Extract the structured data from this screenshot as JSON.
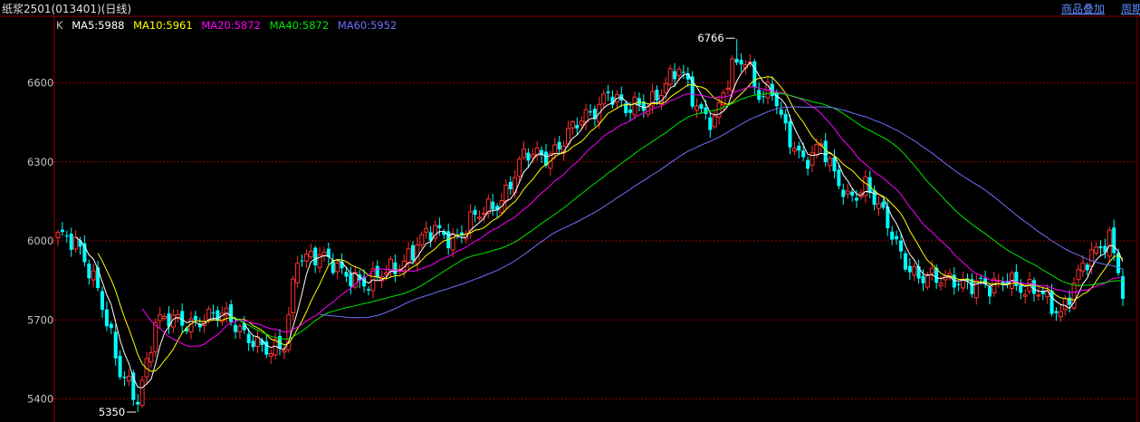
{
  "header": {
    "title": "纸浆2501(013401)(日线)",
    "overlay_link": "商品叠加",
    "period_link": "周期"
  },
  "legend": {
    "k_label": "K",
    "ma5": "MA5:5988",
    "ma10": "MA10:5961",
    "ma20": "MA20:5872",
    "ma40": "MA40:5872",
    "ma60": "MA60:5952"
  },
  "colors": {
    "up": "#ff3232",
    "down": "#00ffff",
    "ma5": "#ffffff",
    "ma10": "#ffff00",
    "ma20": "#ff00ff",
    "ma40": "#00e600",
    "ma60": "#7070ff",
    "grid": "#8b0000",
    "axis": "#8b0000"
  },
  "chart_data": {
    "type": "candlestick",
    "ylim": [
      5350,
      6766
    ],
    "y_ticks": [
      "6600",
      "6300",
      "6000",
      "5700",
      "5400"
    ],
    "annotations": {
      "high": "6766",
      "low": "5350"
    },
    "close_anchors": [
      [
        0,
        6020
      ],
      [
        5,
        5960
      ],
      [
        9,
        5840
      ],
      [
        14,
        5480
      ],
      [
        18,
        5400
      ],
      [
        22,
        5700
      ],
      [
        28,
        5680
      ],
      [
        33,
        5720
      ],
      [
        38,
        5700
      ],
      [
        43,
        5650
      ],
      [
        48,
        5560
      ],
      [
        51,
        5600
      ],
      [
        54,
        5960
      ],
      [
        60,
        5920
      ],
      [
        66,
        5880
      ],
      [
        70,
        5820
      ],
      [
        75,
        5900
      ],
      [
        80,
        5960
      ],
      [
        85,
        6040
      ],
      [
        90,
        6020
      ],
      [
        95,
        6090
      ],
      [
        100,
        6170
      ],
      [
        105,
        6310
      ],
      [
        110,
        6330
      ],
      [
        115,
        6400
      ],
      [
        120,
        6480
      ],
      [
        124,
        6580
      ],
      [
        128,
        6480
      ],
      [
        132,
        6520
      ],
      [
        136,
        6580
      ],
      [
        140,
        6640
      ],
      [
        144,
        6520
      ],
      [
        148,
        6460
      ],
      [
        152,
        6640
      ],
      [
        155,
        6700
      ],
      [
        158,
        6570
      ],
      [
        161,
        6560
      ],
      [
        164,
        6400
      ],
      [
        168,
        6320
      ],
      [
        172,
        6360
      ],
      [
        175,
        6230
      ],
      [
        178,
        6170
      ],
      [
        182,
        6220
      ],
      [
        186,
        6080
      ],
      [
        190,
        5960
      ],
      [
        194,
        5860
      ],
      [
        198,
        5840
      ],
      [
        202,
        5870
      ],
      [
        206,
        5830
      ],
      [
        210,
        5810
      ],
      [
        214,
        5880
      ],
      [
        218,
        5800
      ],
      [
        222,
        5790
      ],
      [
        226,
        5740
      ],
      [
        230,
        5860
      ],
      [
        234,
        5960
      ],
      [
        237,
        6030
      ],
      [
        239,
        5900
      ],
      [
        240,
        5800
      ]
    ],
    "ma_last": {
      "MA5": 5988,
      "MA10": 5961,
      "MA20": 5872,
      "MA40": 5872,
      "MA60": 5952
    }
  }
}
